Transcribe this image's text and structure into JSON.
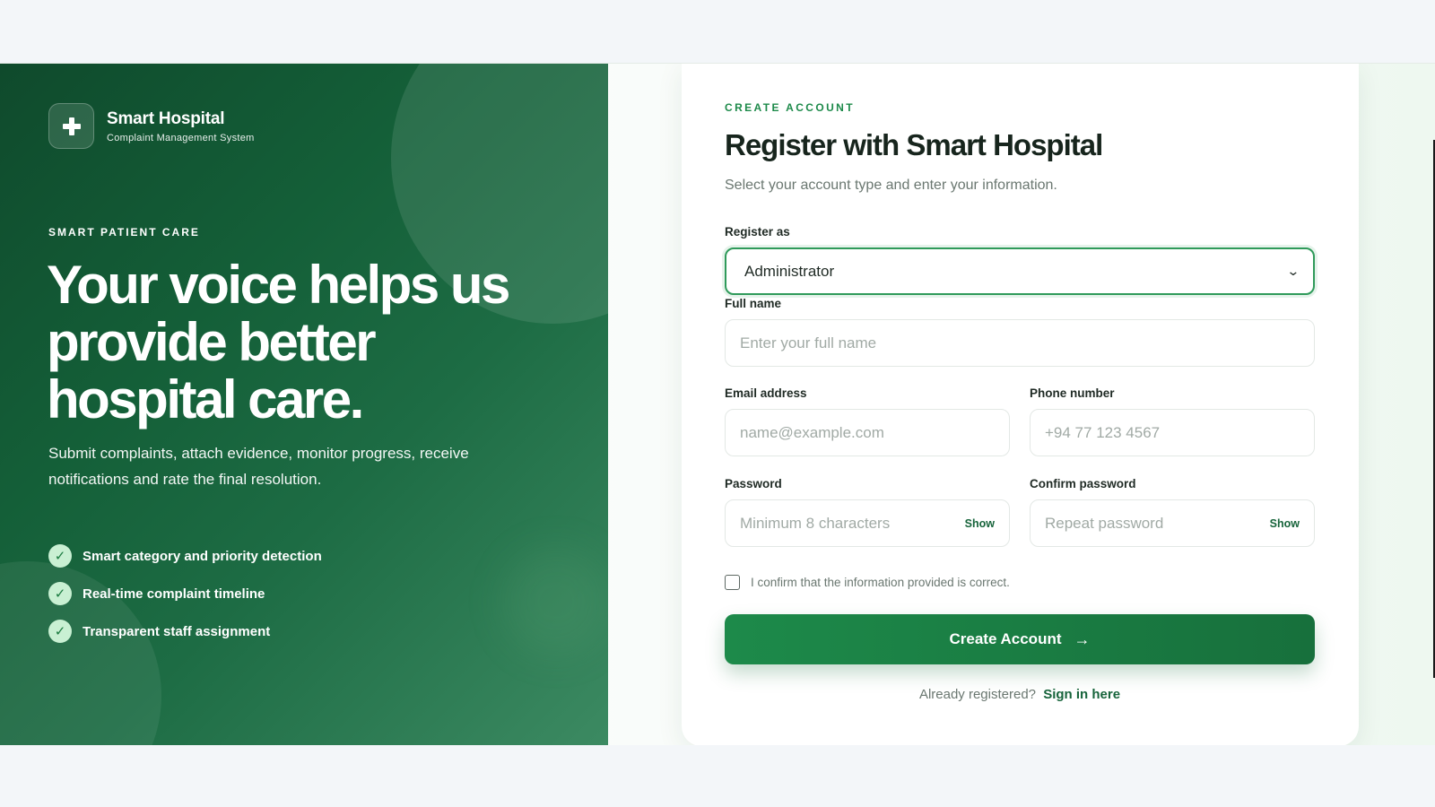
{
  "brand": {
    "name": "Smart Hospital",
    "subtitle": "Complaint Management System",
    "logo_icon": "plus-icon"
  },
  "hero": {
    "eyebrow": "SMART PATIENT CARE",
    "title": "Your voice helps us provide better hospital care.",
    "description": "Submit complaints, attach evidence, monitor progress, receive notifications and rate the final resolution.",
    "features": [
      "Smart category and priority detection",
      "Real-time complaint timeline",
      "Transparent staff assignment"
    ]
  },
  "form": {
    "kicker": "CREATE ACCOUNT",
    "title": "Register with Smart Hospital",
    "subtitle": "Select your account type and enter your information.",
    "register_as": {
      "label": "Register as",
      "value": "Administrator"
    },
    "full_name": {
      "label": "Full name",
      "placeholder": "Enter your full name"
    },
    "email": {
      "label": "Email address",
      "placeholder": "name@example.com"
    },
    "phone": {
      "label": "Phone number",
      "placeholder": "+94 77 123 4567"
    },
    "password": {
      "label": "Password",
      "placeholder": "Minimum 8 characters",
      "toggle": "Show"
    },
    "confirm_password": {
      "label": "Confirm password",
      "placeholder": "Repeat password",
      "toggle": "Show"
    },
    "confirm_checkbox": "I confirm that the information provided is correct.",
    "submit": "Create Account",
    "signin_prompt": "Already registered?",
    "signin_link": "Sign in here"
  },
  "colors": {
    "primary": "#1d8a4a",
    "hero_dark": "#0f4a2c",
    "check_bg": "#c9f0d3"
  }
}
